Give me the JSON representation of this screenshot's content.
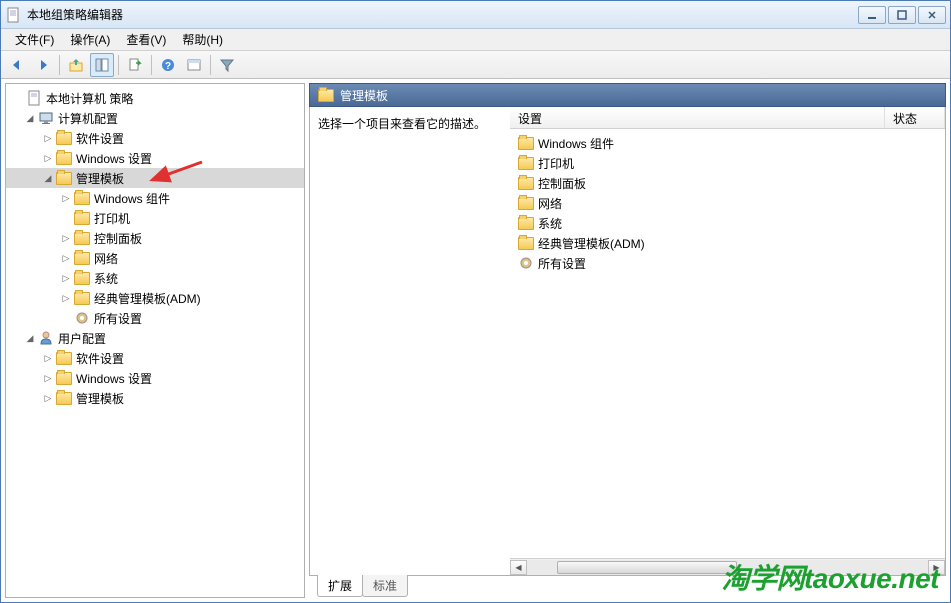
{
  "window": {
    "title": "本地组策略编辑器"
  },
  "menu": {
    "file": "文件(F)",
    "action": "操作(A)",
    "view": "查看(V)",
    "help": "帮助(H)"
  },
  "tree": {
    "root": "本地计算机 策略",
    "computer_config": "计算机配置",
    "cc_software": "软件设置",
    "cc_windows": "Windows 设置",
    "cc_admin": "管理模板",
    "cc_admin_children": {
      "win_comp": "Windows 组件",
      "printer": "打印机",
      "control_panel": "控制面板",
      "network": "网络",
      "system": "系统",
      "classic": "经典管理模板(ADM)",
      "all": "所有设置"
    },
    "user_config": "用户配置",
    "uc_software": "软件设置",
    "uc_windows": "Windows 设置",
    "uc_admin": "管理模板"
  },
  "header": {
    "title": "管理模板"
  },
  "description": {
    "prompt": "选择一个项目来查看它的描述。"
  },
  "columns": {
    "setting": "设置",
    "state": "状态"
  },
  "list": {
    "win_comp": "Windows 组件",
    "printer": "打印机",
    "control_panel": "控制面板",
    "network": "网络",
    "system": "系统",
    "classic": "经典管理模板(ADM)",
    "all": "所有设置"
  },
  "tabs": {
    "extended": "扩展",
    "standard": "标准"
  },
  "watermark": "淘学网taoxue.net"
}
